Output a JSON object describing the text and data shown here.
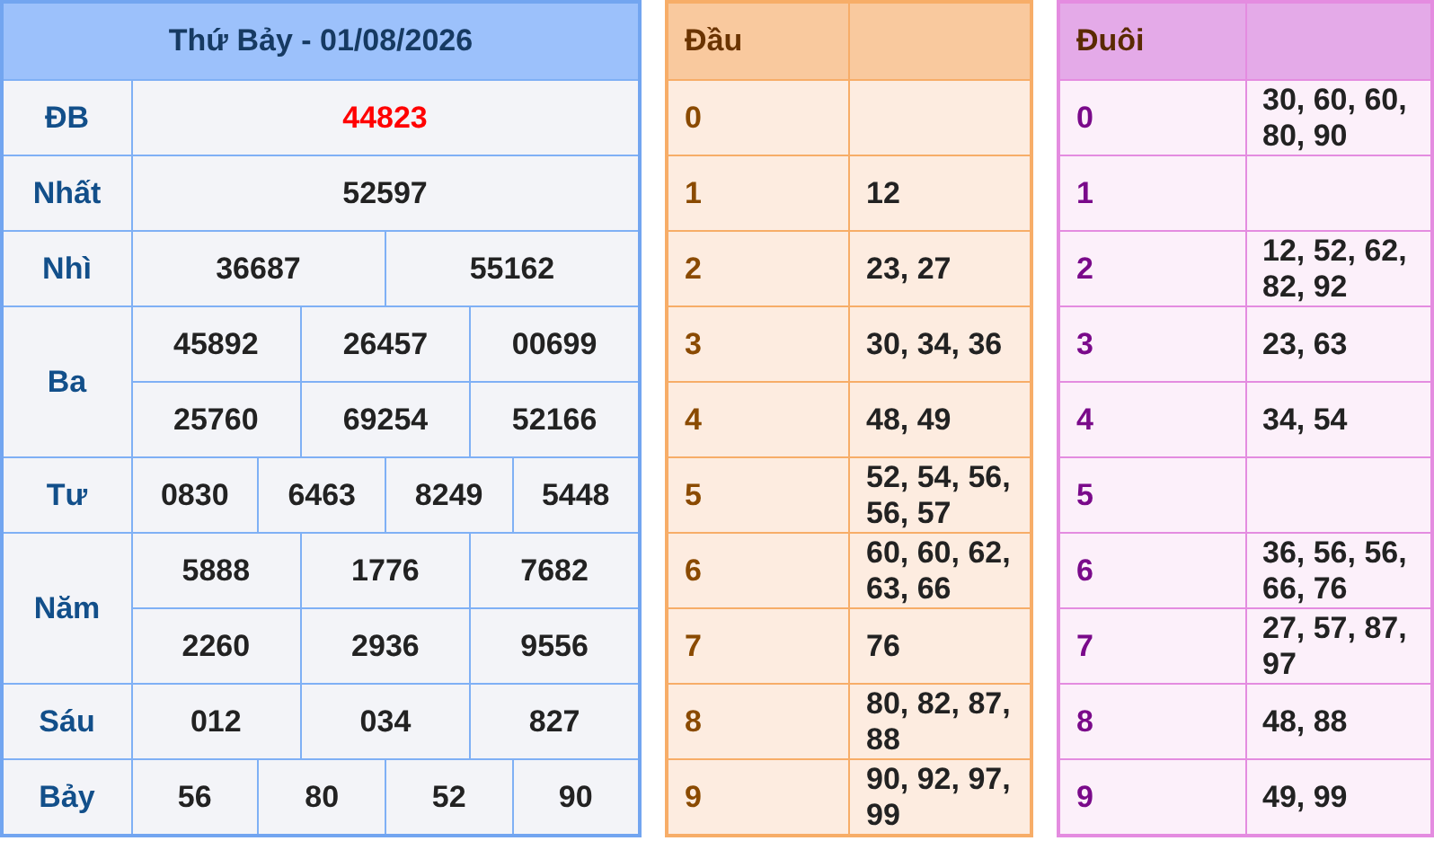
{
  "results": {
    "title": "Thứ Bảy - 01/08/2026",
    "prizes": [
      {
        "label": "ĐB",
        "kind": "special",
        "lines": [
          [
            "44823"
          ]
        ]
      },
      {
        "label": "Nhất",
        "kind": "normal",
        "lines": [
          [
            "52597"
          ]
        ]
      },
      {
        "label": "Nhì",
        "kind": "normal",
        "lines": [
          [
            "36687",
            "55162"
          ]
        ]
      },
      {
        "label": "Ba",
        "kind": "normal",
        "lines": [
          [
            "45892",
            "26457",
            "00699"
          ],
          [
            "25760",
            "69254",
            "52166"
          ]
        ]
      },
      {
        "label": "Tư",
        "kind": "normal",
        "lines": [
          [
            "0830",
            "6463",
            "8249",
            "5448"
          ]
        ]
      },
      {
        "label": "Năm",
        "kind": "normal",
        "lines": [
          [
            "5888",
            "1776",
            "7682"
          ],
          [
            "2260",
            "2936",
            "9556"
          ]
        ]
      },
      {
        "label": "Sáu",
        "kind": "normal",
        "lines": [
          [
            "012",
            "034",
            "827"
          ]
        ]
      },
      {
        "label": "Bảy",
        "kind": "normal",
        "lines": [
          [
            "56",
            "80",
            "52",
            "90"
          ]
        ]
      }
    ]
  },
  "dau": {
    "heading": "Đầu",
    "rows": [
      {
        "digit": "0"
      },
      {
        "digit": "1",
        "values": "12"
      },
      {
        "digit": "2",
        "values": "23, 27"
      },
      {
        "digit": "3",
        "values": "30, 34, 36"
      },
      {
        "digit": "4",
        "values": "48, 49"
      },
      {
        "digit": "5",
        "values": "52, 54, 56, 56, 57"
      },
      {
        "digit": "6",
        "values": "60, 60, 62, 63, 66"
      },
      {
        "digit": "7",
        "values": "76"
      },
      {
        "digit": "8",
        "values": "80, 82, 87, 88"
      },
      {
        "digit": "9",
        "values": "90, 92, 97, 99"
      }
    ]
  },
  "duoi": {
    "heading": "Đuôi",
    "rows": [
      {
        "digit": "0",
        "values": "30, 60, 60, 80, 90"
      },
      {
        "digit": "1"
      },
      {
        "digit": "2",
        "values": "12, 52, 62, 82, 92"
      },
      {
        "digit": "3",
        "values": "23, 63"
      },
      {
        "digit": "4",
        "values": "34, 54"
      },
      {
        "digit": "5"
      },
      {
        "digit": "6",
        "values": "36, 56, 56, 66, 76"
      },
      {
        "digit": "7",
        "values": "27, 57, 87, 97"
      },
      {
        "digit": "8",
        "values": "48, 88"
      },
      {
        "digit": "9",
        "values": "49, 99"
      }
    ]
  }
}
